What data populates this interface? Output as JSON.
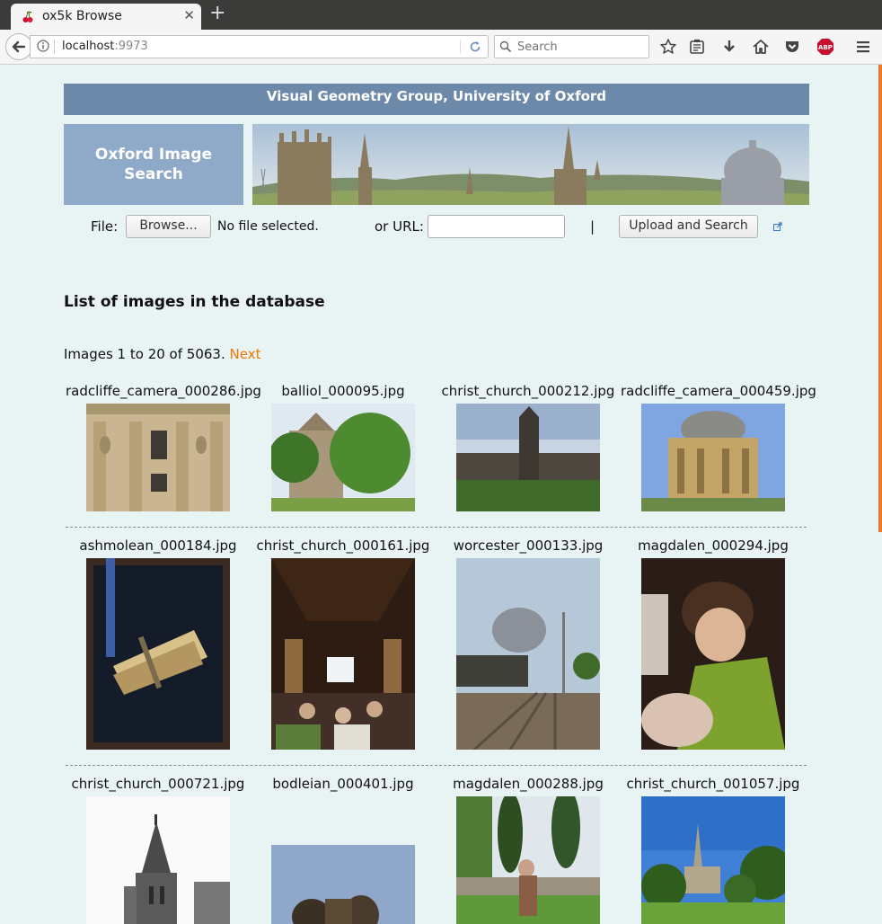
{
  "browser": {
    "tab_title": "ox5k Browse",
    "url_host": "localhost",
    "url_port": ":9973",
    "search_placeholder": "Search"
  },
  "header": {
    "group": "Visual Geometry Group, University of Oxford",
    "title_line1": "Oxford Image",
    "title_line2": "Search"
  },
  "upload": {
    "file_label": "File:",
    "browse_label": "Browse...",
    "no_file": "No file selected.",
    "url_label": "or URL:",
    "separator": "|",
    "submit_label": "Upload and Search"
  },
  "main": {
    "heading": "List of images in the database",
    "count_text": "Images 1 to 20 of 5063.",
    "next_label": "Next"
  },
  "images": [
    {
      "name": "radcliffe_camera_000286.jpg"
    },
    {
      "name": "balliol_000095.jpg"
    },
    {
      "name": "christ_church_000212.jpg"
    },
    {
      "name": "radcliffe_camera_000459.jpg"
    },
    {
      "name": "ashmolean_000184.jpg"
    },
    {
      "name": "christ_church_000161.jpg"
    },
    {
      "name": "worcester_000133.jpg"
    },
    {
      "name": "magdalen_000294.jpg"
    },
    {
      "name": "christ_church_000721.jpg"
    },
    {
      "name": "bodleian_000401.jpg"
    },
    {
      "name": "magdalen_000288.jpg"
    },
    {
      "name": "christ_church_001057.jpg"
    }
  ]
}
